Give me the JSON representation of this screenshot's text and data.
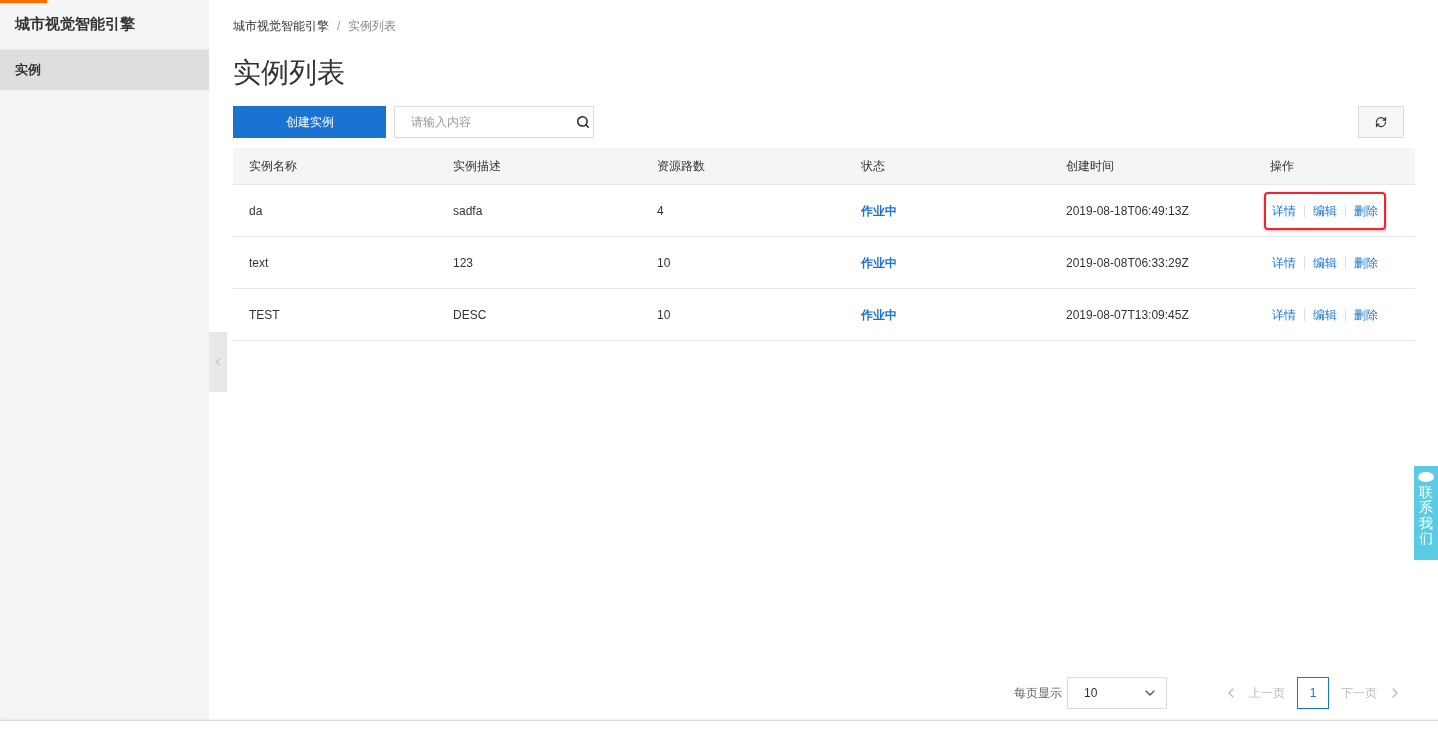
{
  "sidebar": {
    "title": "城市视觉智能引擎",
    "items": [
      {
        "label": "实例",
        "selected": true
      }
    ]
  },
  "loading_bar": {
    "level": 0.033
  },
  "breadcrumb": [
    "城市视觉智能引擎",
    "实例列表"
  ],
  "breadcrumb_separator": "/",
  "page_title": "实例列表",
  "toolbar": {
    "create_button": "创建实例",
    "search": {
      "placeholder": "请输入内容"
    }
  },
  "table": {
    "columns": [
      "实例名称",
      "实例描述",
      "资源路数",
      "状态",
      "创建时间",
      "操作"
    ],
    "rows": [
      {
        "cells": [
          "da",
          "sadfa",
          "4",
          "作业中",
          "2019-08-18T06:49:13Z"
        ],
        "actions": [
          "详情",
          "编辑",
          "删除"
        ],
        "outlined": true
      },
      {
        "cells": [
          "text",
          "123",
          "10",
          "作业中",
          "2019-08-08T06:33:29Z"
        ],
        "actions": [
          "详情",
          "编辑",
          "删除"
        ],
        "outlined": false
      },
      {
        "cells": [
          "TEST",
          "DESC",
          "10",
          "作业中",
          "2019-08-07T13:09:45Z"
        ],
        "actions": [
          "详情",
          "编辑",
          "删除"
        ],
        "outlined": false
      }
    ]
  },
  "pagination": {
    "page_size_label": "每页显示",
    "page_size": "10",
    "prev": {
      "label": "上一页",
      "disabled": true
    },
    "pages": [
      {
        "label": "1",
        "selected": true
      }
    ],
    "next": {
      "label": "下一页",
      "disabled": true
    }
  },
  "contact_tab": "联系我们"
}
